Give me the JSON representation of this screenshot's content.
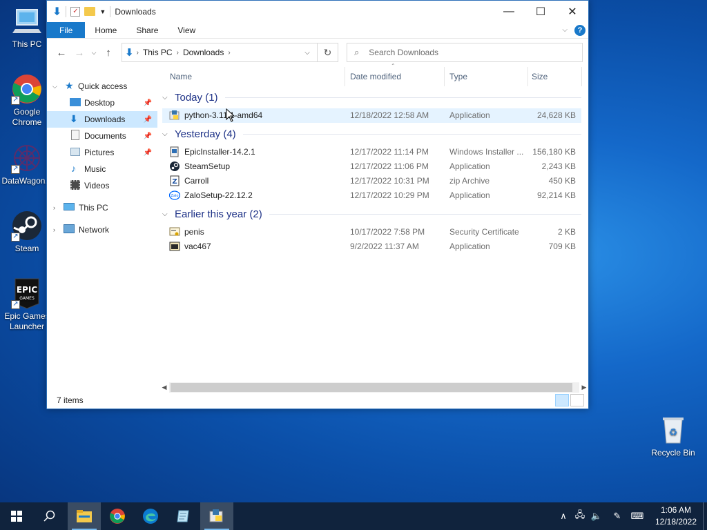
{
  "desktop": {
    "icons": [
      {
        "label": "This PC"
      },
      {
        "label": "Google Chrome"
      },
      {
        "label": "DataWagon..."
      },
      {
        "label": "Steam"
      },
      {
        "label": "Epic Games Launcher"
      },
      {
        "label": "Recycle Bin"
      }
    ]
  },
  "window": {
    "title": "Downloads",
    "ribbon_tabs": [
      "File",
      "Home",
      "Share",
      "View"
    ],
    "address": {
      "crumbs": [
        "This PC",
        "Downloads"
      ]
    },
    "search_placeholder": "Search Downloads",
    "nav": {
      "quick_access": "Quick access",
      "items": [
        {
          "label": "Desktop",
          "pinned": true
        },
        {
          "label": "Downloads",
          "pinned": true
        },
        {
          "label": "Documents",
          "pinned": true
        },
        {
          "label": "Pictures",
          "pinned": true
        },
        {
          "label": "Music",
          "pinned": false
        },
        {
          "label": "Videos",
          "pinned": false
        }
      ],
      "this_pc": "This PC",
      "network": "Network"
    },
    "columns": [
      "Name",
      "Date modified",
      "Type",
      "Size"
    ],
    "groups": [
      {
        "label": "Today (1)",
        "files": [
          {
            "name": "python-3.11.1-amd64",
            "date": "12/18/2022 12:58 AM",
            "type": "Application",
            "size": "24,628 KB"
          }
        ]
      },
      {
        "label": "Yesterday (4)",
        "files": [
          {
            "name": "EpicInstaller-14.2.1",
            "date": "12/17/2022 11:14 PM",
            "type": "Windows Installer ...",
            "size": "156,180 KB"
          },
          {
            "name": "SteamSetup",
            "date": "12/17/2022 11:06 PM",
            "type": "Application",
            "size": "2,243 KB"
          },
          {
            "name": "Carroll",
            "date": "12/17/2022 10:31 PM",
            "type": "zip Archive",
            "size": "450 KB"
          },
          {
            "name": "ZaloSetup-22.12.2",
            "date": "12/17/2022 10:29 PM",
            "type": "Application",
            "size": "92,214 KB"
          }
        ]
      },
      {
        "label": "Earlier this year (2)",
        "files": [
          {
            "name": "penis",
            "date": "10/17/2022 7:58 PM",
            "type": "Security Certificate",
            "size": "2 KB"
          },
          {
            "name": "vac467",
            "date": "9/2/2022 11:37 AM",
            "type": "Application",
            "size": "709 KB"
          }
        ]
      }
    ],
    "status": "7 items"
  },
  "taskbar": {
    "time": "1:06 AM",
    "date": "12/18/2022"
  },
  "colors": {
    "accent": "#1979ca",
    "selected": "#cce8ff",
    "group_text": "#1e3287",
    "taskbar": "#10233d"
  }
}
